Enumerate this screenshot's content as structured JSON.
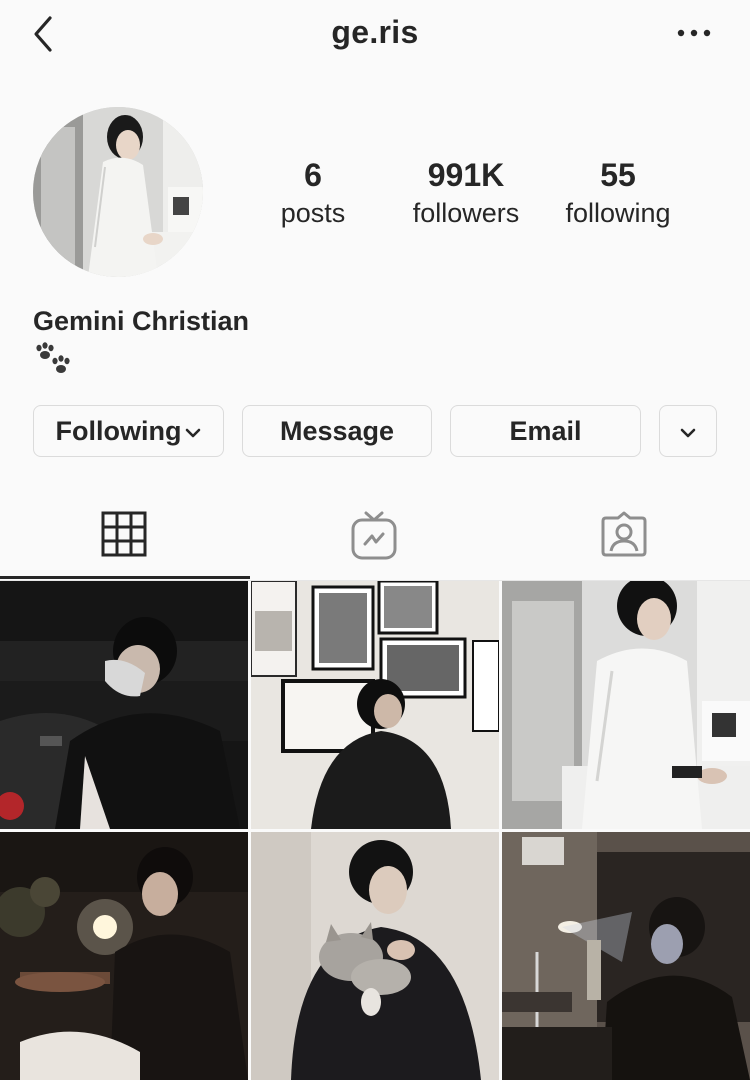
{
  "header": {
    "username": "ge.ris",
    "back_icon": "chevron-left-icon",
    "more_icon": "more-horizontal-icon"
  },
  "profile": {
    "avatar_icon": "profile-photo",
    "name": "Gemini Christian",
    "bio_emoji_icon": "paw-prints-icon",
    "stats": [
      {
        "value": "6",
        "label": "posts"
      },
      {
        "value": "991K",
        "label": "followers"
      },
      {
        "value": "55",
        "label": "following"
      }
    ]
  },
  "actions": {
    "following": "Following",
    "message": "Message",
    "email": "Email",
    "more_icon": "chevron-down-icon"
  },
  "tabs": [
    {
      "icon": "grid-icon",
      "active": true
    },
    {
      "icon": "igtv-icon",
      "active": false
    },
    {
      "icon": "tagged-user-icon",
      "active": false
    }
  ],
  "posts": [
    {
      "description_icon": "photo-cinema-mask"
    },
    {
      "description_icon": "photo-gallery-wall"
    },
    {
      "description_icon": "photo-kitchen-white-shirt"
    },
    {
      "description_icon": "photo-bar-candle"
    },
    {
      "description_icon": "photo-cat-hold"
    },
    {
      "description_icon": "photo-lamp-room"
    }
  ],
  "colors": {
    "background": "#fafafa",
    "text": "#262626",
    "border": "#dbdbdb"
  }
}
